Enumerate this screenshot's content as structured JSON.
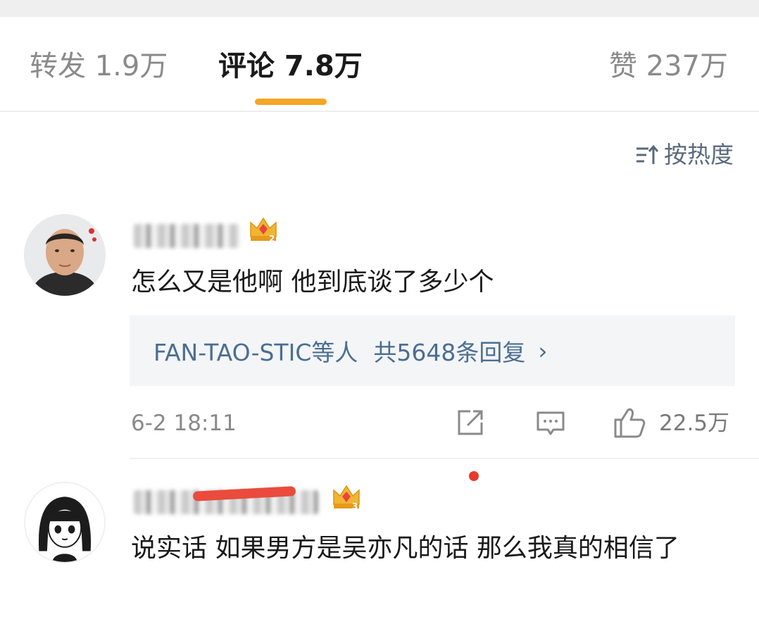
{
  "tabs": {
    "repost": "转发 1.9万",
    "comment": "评论 7.8万",
    "like": "赞 237万"
  },
  "sort": {
    "label": "按热度",
    "icon": "sort-icon"
  },
  "colors": {
    "accent": "#f5a623",
    "link": "#4a6e93",
    "alert": "#e83a2c"
  },
  "comments": [
    {
      "text": "怎么又是他啊 他到底谈了多少个",
      "badge_level": "2",
      "replies": {
        "users": "FAN-TAO-STIC等人",
        "count": "共5648条回复",
        "arrow": "›"
      },
      "time": "6-2 18:11",
      "likes": "22.5万"
    },
    {
      "text": "说实话 如果男方是吴亦凡的话 那么我真的相信了",
      "badge_level": "3"
    }
  ]
}
